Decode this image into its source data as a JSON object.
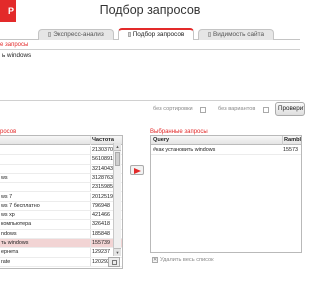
{
  "app": {
    "logo_text": "P",
    "title": "Подбор запросов"
  },
  "tabs": [
    {
      "label": "Экспресс-анализ"
    },
    {
      "label": "Подбор запросов"
    },
    {
      "label": "Видимость сайта"
    }
  ],
  "query_section": {
    "label": "е запросы",
    "value": "ь windows"
  },
  "options": {
    "no_sort_label": "без сортировки",
    "no_variants_label": "без вариантов",
    "check_button_label": "Проверит"
  },
  "search_results": {
    "label": "росов",
    "columns": [
      "",
      "Частота"
    ],
    "rows": [
      {
        "phrase": "",
        "freq": "21303708"
      },
      {
        "phrase": "",
        "freq": "5610891"
      },
      {
        "phrase": "",
        "freq": "3214043"
      },
      {
        "phrase": "ws",
        "freq": "3128763"
      },
      {
        "phrase": "",
        "freq": "2315985"
      },
      {
        "phrase": "ws 7",
        "freq": "2012519"
      },
      {
        "phrase": "ws 7 бесплатно",
        "freq": "796948"
      },
      {
        "phrase": "ws xp",
        "freq": "421466"
      },
      {
        "phrase": "компьютера",
        "freq": "326418"
      },
      {
        "phrase": "ndows",
        "freq": "185848"
      },
      {
        "phrase": "ть windows",
        "freq": "155739",
        "selected": true
      },
      {
        "phrase": "ернета",
        "freq": "129237"
      },
      {
        "phrase": "rate",
        "freq": "120293"
      }
    ],
    "scroll_up": "▲",
    "scroll_down": "▼"
  },
  "selected_queries": {
    "label": "Выбранные запросы",
    "columns": [
      "Query",
      "Rambl"
    ],
    "rows": [
      {
        "query": "#как установить windows",
        "freq": "15573"
      }
    ],
    "clear_label": "Удалить весь список"
  }
}
